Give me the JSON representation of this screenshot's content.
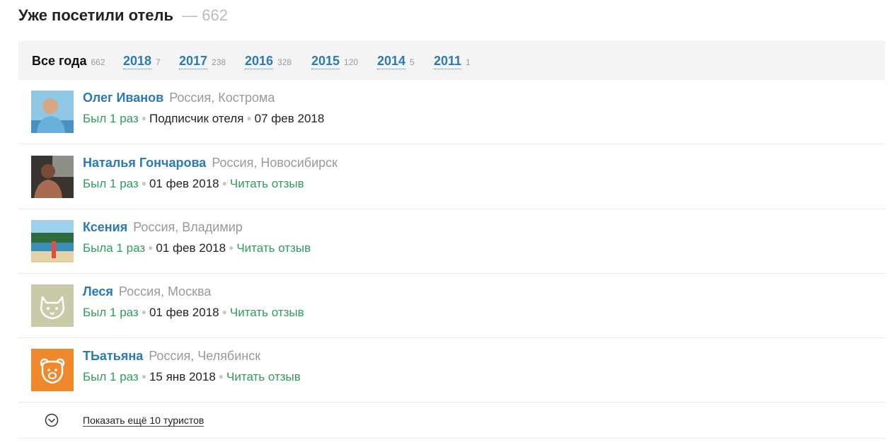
{
  "header": {
    "title": "Уже посетили отель",
    "dash": "—",
    "count": "662"
  },
  "tabs": [
    {
      "label": "Все года",
      "count": "662",
      "active": true
    },
    {
      "label": "2018",
      "count": "7"
    },
    {
      "label": "2017",
      "count": "238"
    },
    {
      "label": "2016",
      "count": "328"
    },
    {
      "label": "2015",
      "count": "120"
    },
    {
      "label": "2014",
      "count": "5"
    },
    {
      "label": "2011",
      "count": "1"
    }
  ],
  "visitors": [
    {
      "name": "Олег Иванов",
      "location": "Россия, Кострома",
      "visits": "Был 1 раз",
      "extra": "Подписчик отеля",
      "date": "07 фев 2018",
      "avatar": "photo-avatar"
    },
    {
      "name": "Наталья Гончарова",
      "location": "Россия, Новосибирск",
      "visits": "Был 1 раз",
      "date": "01 фев 2018",
      "review": "Читать отзыв",
      "avatar": "photo-avatar"
    },
    {
      "name": "Ксения",
      "location": "Россия, Владимир",
      "visits": "Была 1 раз",
      "date": "01 фев 2018",
      "review": "Читать отзыв",
      "avatar": "photo-avatar"
    },
    {
      "name": "Леся",
      "location": "Россия, Москва",
      "visits": "Был 1 раз",
      "date": "01 фев 2018",
      "review": "Читать отзыв",
      "avatar": "cat-icon",
      "avatar_color": "#c9cba8"
    },
    {
      "name": "ТЬатьяна",
      "location": "Россия, Челябинск",
      "visits": "Был 1 раз",
      "date": "15 янв 2018",
      "review": "Читать отзыв",
      "avatar": "bear-icon",
      "avatar_color": "#f0892c"
    }
  ],
  "show_more": {
    "label": "Показать ещё 10 туристов",
    "icon": "chevron-down-icon"
  },
  "colors": {
    "link": "#2a7ab7",
    "green": "#2e9e59",
    "muted": "#999999",
    "tabs_bg": "#f4f4f4"
  }
}
